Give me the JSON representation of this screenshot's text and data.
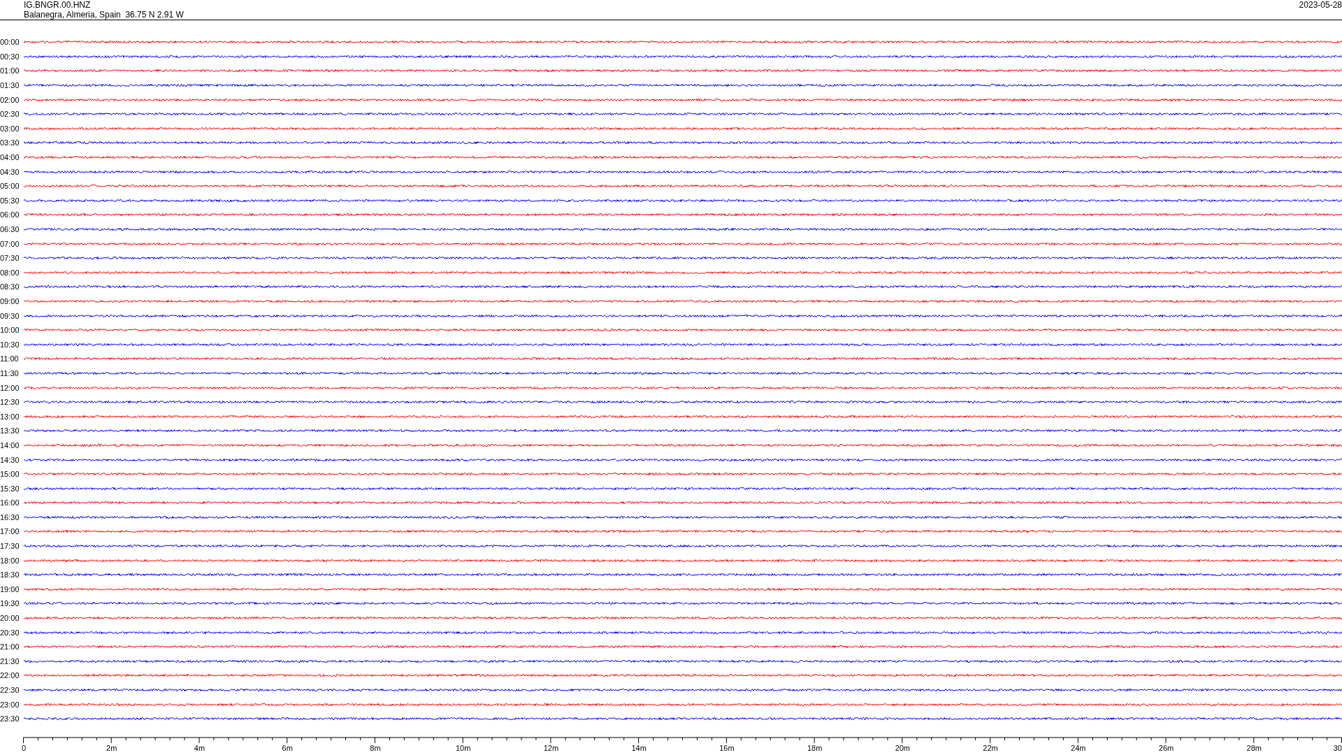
{
  "header": {
    "station": "IG.BNGR.00.HNZ",
    "location": "Balanegra, Almeria, Spain  36.75 N 2.91 W",
    "date": "2023-05-28"
  },
  "traces": [
    {
      "label": "00:00",
      "color": "#ff0000"
    },
    {
      "label": "00:30",
      "color": "#0000ff"
    },
    {
      "label": "01:00",
      "color": "#ff0000"
    },
    {
      "label": "01:30",
      "color": "#0000ff"
    },
    {
      "label": "02:00",
      "color": "#ff0000"
    },
    {
      "label": "02:30",
      "color": "#0000ff"
    },
    {
      "label": "03:00",
      "color": "#ff0000"
    },
    {
      "label": "03:30",
      "color": "#0000ff"
    },
    {
      "label": "04:00",
      "color": "#ff0000"
    },
    {
      "label": "04:30",
      "color": "#0000ff"
    },
    {
      "label": "05:00",
      "color": "#ff0000"
    },
    {
      "label": "05:30",
      "color": "#0000ff"
    },
    {
      "label": "06:00",
      "color": "#ff0000"
    },
    {
      "label": "06:30",
      "color": "#0000ff"
    },
    {
      "label": "07:00",
      "color": "#ff0000"
    },
    {
      "label": "07:30",
      "color": "#0000ff"
    },
    {
      "label": "08:00",
      "color": "#ff0000"
    },
    {
      "label": "08:30",
      "color": "#0000ff"
    },
    {
      "label": "09:00",
      "color": "#ff0000"
    },
    {
      "label": "09:30",
      "color": "#0000ff"
    },
    {
      "label": "10:00",
      "color": "#ff0000"
    },
    {
      "label": "10:30",
      "color": "#0000ff"
    },
    {
      "label": "11:00",
      "color": "#ff0000"
    },
    {
      "label": "11:30",
      "color": "#0000ff"
    },
    {
      "label": "12:00",
      "color": "#ff0000"
    },
    {
      "label": "12:30",
      "color": "#0000ff"
    },
    {
      "label": "13:00",
      "color": "#ff0000"
    },
    {
      "label": "13:30",
      "color": "#0000ff"
    },
    {
      "label": "14:00",
      "color": "#ff0000"
    },
    {
      "label": "14:30",
      "color": "#0000ff"
    },
    {
      "label": "15:00",
      "color": "#ff0000"
    },
    {
      "label": "15:30",
      "color": "#0000ff"
    },
    {
      "label": "16:00",
      "color": "#ff0000"
    },
    {
      "label": "16:30",
      "color": "#0000ff"
    },
    {
      "label": "17:00",
      "color": "#ff0000"
    },
    {
      "label": "17:30",
      "color": "#0000ff"
    },
    {
      "label": "18:00",
      "color": "#ff0000"
    },
    {
      "label": "18:30",
      "color": "#0000ff"
    },
    {
      "label": "19:00",
      "color": "#ff0000"
    },
    {
      "label": "19:30",
      "color": "#0000ff"
    },
    {
      "label": "20:00",
      "color": "#ff0000"
    },
    {
      "label": "20:30",
      "color": "#0000ff"
    },
    {
      "label": "21:00",
      "color": "#ff0000"
    },
    {
      "label": "21:30",
      "color": "#0000ff"
    },
    {
      "label": "22:00",
      "color": "#ff0000"
    },
    {
      "label": "22:30",
      "color": "#0000ff"
    },
    {
      "label": "23:00",
      "color": "#ff0000"
    },
    {
      "label": "23:30",
      "color": "#0000ff"
    }
  ],
  "axis": {
    "labels": [
      "0",
      "2m",
      "4m",
      "6m",
      "8m",
      "10m",
      "12m",
      "14m",
      "16m",
      "18m",
      "20m",
      "22m",
      "24m",
      "26m",
      "28m",
      "30"
    ]
  }
}
